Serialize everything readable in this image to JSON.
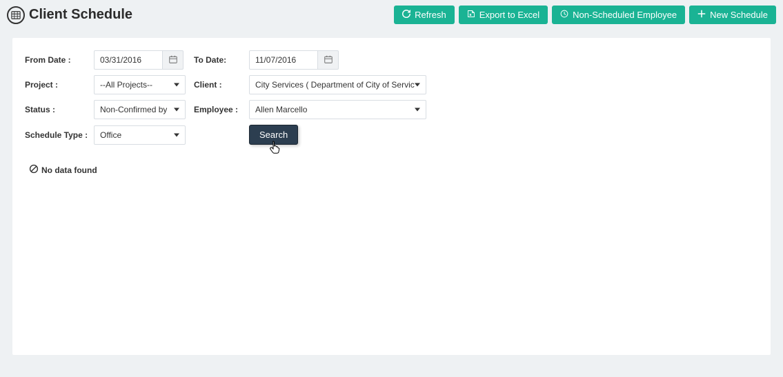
{
  "header": {
    "title": "Client Schedule"
  },
  "actions": {
    "refresh": "Refresh",
    "export": "Export to Excel",
    "nonscheduled": "Non-Scheduled Employee",
    "newschedule": "New Schedule"
  },
  "filters": {
    "fromDateLabel": "From Date :",
    "fromDate": "03/31/2016",
    "toDateLabel": "To Date:",
    "toDate": "11/07/2016",
    "projectLabel": "Project :",
    "project": "--All Projects--",
    "clientLabel": "Client :",
    "client": "City Services ( Department of City of Servic",
    "statusLabel": "Status :",
    "status": "Non-Confirmed by ",
    "employeeLabel": "Employee :",
    "employee": "Allen Marcello",
    "scheduleTypeLabel": "Schedule Type :",
    "scheduleType": "Office",
    "searchLabel": "Search"
  },
  "results": {
    "empty": "No data found"
  }
}
